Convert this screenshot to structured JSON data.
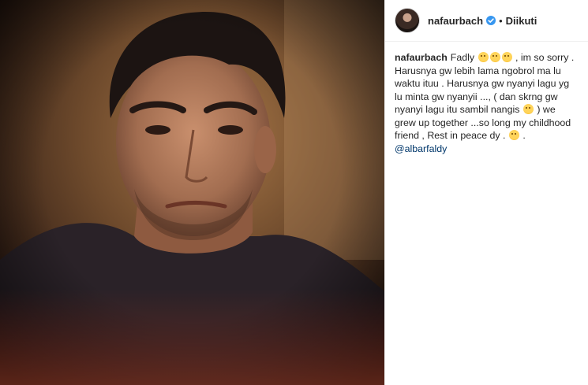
{
  "post": {
    "username": "nafaurbach",
    "dot": "•",
    "follow_status": "Diikuti",
    "caption_user": "nafaurbach",
    "caption": {
      "part1": "Fadly",
      "part2": ", im so sorry . Harusnya gw lebih lama ngobrol ma lu waktu ituu . Harusnya gw nyanyi lagu yg lu minta gw nyanyii ..., ( dan skrng gw nyanyi lagu itu sambil nangis",
      "part3": ") we grew up together ...so long my childhood friend , Rest in peace dy .",
      "part4": ".",
      "mention": "@albarfaldy"
    },
    "icons": {
      "avatar": "profile-avatar",
      "verified": "verified-badge-icon",
      "emoji": "sad-face-emoji-icon"
    },
    "colors": {
      "verified": "#3897f0",
      "mention": "#00376b",
      "text": "#262626"
    }
  }
}
